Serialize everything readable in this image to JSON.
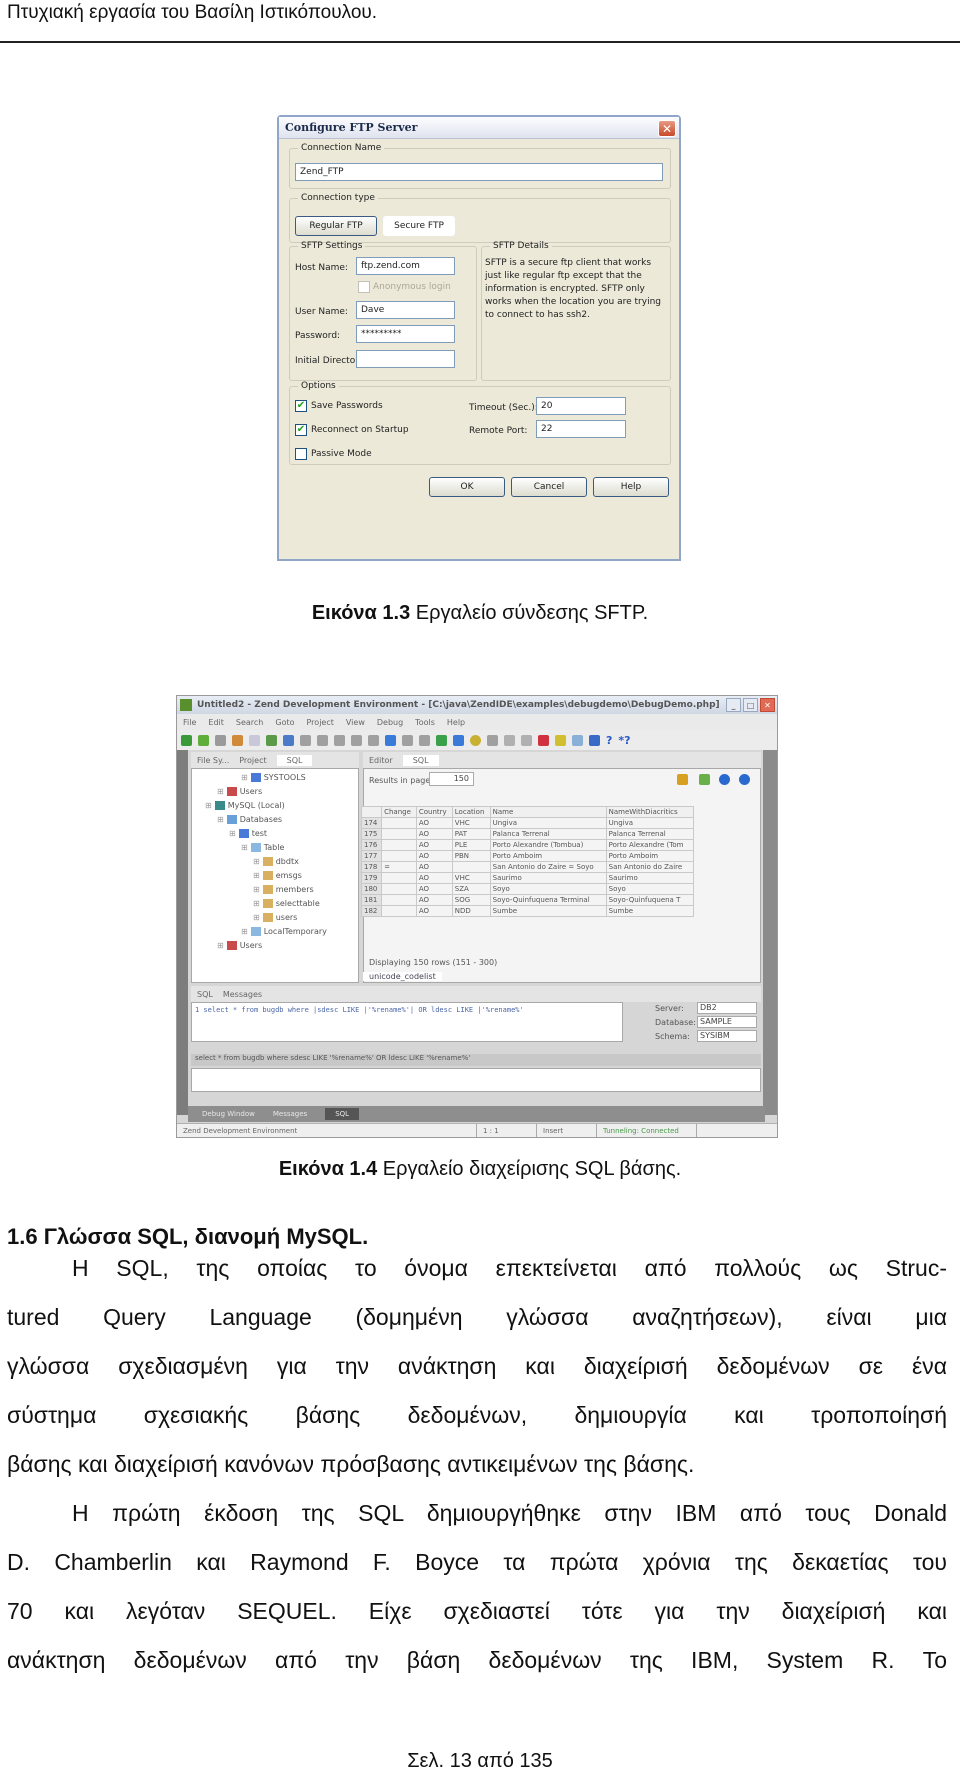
{
  "running_header": "Πτυχιακή εργασία του Βασίλη Ιστικόπουλου.",
  "figure_1_3": {
    "caption_label": "Εικόνα 1.3",
    "caption_text": " Εργαλείο σύνδεσης SFTP.",
    "dialog": {
      "title": "Configure FTP Server",
      "close_glyph": "✕",
      "connection_name_legend": "Connection Name",
      "connection_name_value": "Zend_FTP",
      "connection_type_legend": "Connection type",
      "regular_ftp_label": "Regular FTP",
      "secure_ftp_label": "Secure FTP",
      "sftp_settings_legend": "SFTP Settings",
      "host_name_label": "Host Name:",
      "host_name_value": "ftp.zend.com",
      "anonymous_login_label": "Anonymous login",
      "user_name_label": "User Name:",
      "user_name_value": "Dave",
      "password_label": "Password:",
      "password_value": "*********",
      "initial_directory_label": "Initial Directory:",
      "initial_directory_value": "",
      "sftp_details_legend": "SFTP Details",
      "sftp_details_text": "SFTP is a secure ftp client that works just like regular ftp except that the information is encrypted. SFTP only works when the location you are trying to connect to has ssh2.",
      "options_legend": "Options",
      "save_passwords_label": "Save Passwords",
      "save_passwords_checked": true,
      "reconnect_label": "Reconnect on Startup",
      "reconnect_checked": true,
      "passive_mode_label": "Passive Mode",
      "passive_mode_checked": false,
      "timeout_label": "Timeout (Sec.):",
      "timeout_value": "20",
      "remote_port_label": "Remote Port:",
      "remote_port_value": "22",
      "ok_label": "OK",
      "cancel_label": "Cancel",
      "help_label": "Help",
      "check_glyph": "✔"
    }
  },
  "figure_1_4": {
    "caption_label": "Εικόνα 1.4",
    "caption_text": " Εργαλείο διαχείρισης SQL βάσης.",
    "ide": {
      "title": "Untitled2 - Zend Development Environment - [C:\\java\\ZendIDE\\examples\\debugdemo\\DebugDemo.php]",
      "menu": [
        "File",
        "Edit",
        "Search",
        "Goto",
        "Project",
        "View",
        "Debug",
        "Tools",
        "Help"
      ],
      "left_tabs": [
        "File Sy...",
        "Project",
        "SQL"
      ],
      "tree": [
        {
          "label": "SYSTOOLS",
          "level": 4
        },
        {
          "label": "Users",
          "level": 2
        },
        {
          "label": "MySQL (Local)",
          "level": 1
        },
        {
          "label": "Databases",
          "level": 2
        },
        {
          "label": "test",
          "level": 3
        },
        {
          "label": "Table",
          "level": 4
        },
        {
          "label": "dbdtx",
          "level": 5
        },
        {
          "label": "emsgs",
          "level": 5
        },
        {
          "label": "members",
          "level": 5
        },
        {
          "label": "selecttable",
          "level": 5
        },
        {
          "label": "users",
          "level": 5
        },
        {
          "label": "LocalTemporary",
          "level": 4
        },
        {
          "label": "Users",
          "level": 2
        }
      ],
      "right_tabs": [
        "Editor",
        "SQL"
      ],
      "results_in_page_label": "Results in page:",
      "results_in_page_value": "150",
      "columns": [
        "",
        "Change",
        "Country",
        "Location",
        "Name",
        "NameWithDiacritics"
      ],
      "rows": [
        [
          "174",
          "",
          "AO",
          "VHC",
          "Ungiva",
          "Ungiva"
        ],
        [
          "175",
          "",
          "AO",
          "PAT",
          "Palanca Terrenal",
          "Palanca Terrenal"
        ],
        [
          "176",
          "",
          "AO",
          "PLE",
          "Porto Alexandre (Tombua)",
          "Porto Alexandre (Tom"
        ],
        [
          "177",
          "",
          "AO",
          "PBN",
          "Porto Amboim",
          "Porto Amboim"
        ],
        [
          "178",
          "=",
          "AO",
          "",
          "San Antonio do Zaire = Soyo",
          "San Antonio do Zaire"
        ],
        [
          "179",
          "",
          "AO",
          "VHC",
          "Saurimo",
          "Saurimo"
        ],
        [
          "180",
          "",
          "AO",
          "SZA",
          "Soyo",
          "Soyo"
        ],
        [
          "181",
          "",
          "AO",
          "SOG",
          "Soyo-Quinfuquena Terminal",
          "Soyo-Quinfuquena T"
        ],
        [
          "182",
          "",
          "AO",
          "NDD",
          "Sumbe",
          "Sumbe"
        ]
      ],
      "displaying_text": "Displaying 150 rows (151 - 300)",
      "bottom_tab": "unicode_codelist",
      "lower_tabs": [
        "SQL",
        "Messages"
      ],
      "sql_query": "1 select * from bugdb where |sdesc LIKE |'%rename%'| OR ldesc LIKE |'%rename%'",
      "sql_status": "select * from bugdb where sdesc LIKE '%rename%' OR ldesc LIKE '%rename%'",
      "server_label": "Server:",
      "server_value": "DB2",
      "database_label": "Database:",
      "database_value": "SAMPLE",
      "schema_label": "Schema:",
      "schema_value": "SYSIBM",
      "dock_tabs": [
        "Debug Window",
        "Messages",
        "SQL"
      ],
      "status": [
        "Zend Development Environment",
        "1 : 1",
        "Insert",
        "Tunneling: Connected"
      ]
    }
  },
  "section": {
    "title": "1.6 Γλώσσα SQL, διανομή MySQL.",
    "paragraph_1_lines": [
      "Η SQL, της οποίας το όνομα επεκτείνεται από πολλούς ως Struc-",
      "tured Query Language (δομημένη γλώσσα αναζητήσεων), είναι μια",
      "γλώσσα σχεδιασμένη για την ανάκτηση και διαχείρισή δεδομένων σε ένα",
      "σύστημα σχεσιακής βάσης δεδομένων, δημιουργία και τροποποίησή",
      "βάσης και διαχείρισή κανόνων πρόσβασης αντικειμένων της βάσης."
    ],
    "paragraph_2_lines": [
      "Η πρώτη έκδοση της SQL δημιουργήθηκε στην IBM από τους Donald",
      "D. Chamberlin και Raymond F. Boyce τα πρώτα χρόνια της δεκαετίας του",
      "70 και λεγόταν SEQUEL. Είχε σχεδιαστεί τότε για την διαχείρισή και",
      "ανάκτηση δεδομένων από την βάση δεδομένων της IBM, System R. Το"
    ]
  },
  "page_number": "Σελ. 13 από 135"
}
